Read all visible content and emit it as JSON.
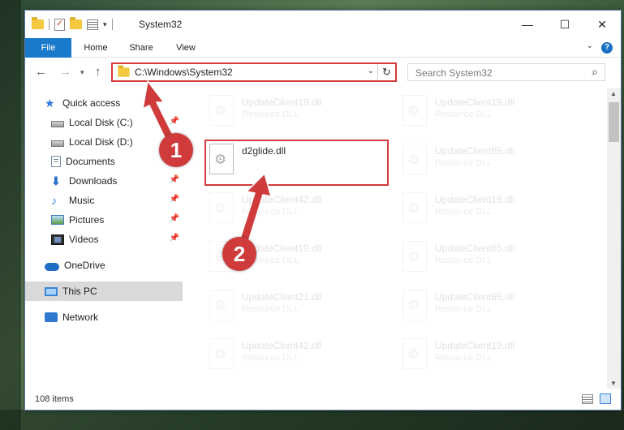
{
  "window": {
    "title": "System32"
  },
  "ribbon": {
    "tabs": [
      "File",
      "Home",
      "Share",
      "View"
    ]
  },
  "address": {
    "path": "C:\\Windows\\System32"
  },
  "search": {
    "placeholder": "Search System32"
  },
  "sidebar": {
    "items": [
      {
        "label": "Quick access",
        "icon": "quick-access-star-icon",
        "pinned": false
      },
      {
        "label": "Local Disk (C:)",
        "icon": "drive-icon",
        "pinned": true
      },
      {
        "label": "Local Disk (D:)",
        "icon": "drive-icon",
        "pinned": false
      },
      {
        "label": "Documents",
        "icon": "documents-icon",
        "pinned": true
      },
      {
        "label": "Downloads",
        "icon": "downloads-icon",
        "pinned": true
      },
      {
        "label": "Music",
        "icon": "music-icon",
        "pinned": true
      },
      {
        "label": "Pictures",
        "icon": "pictures-icon",
        "pinned": true
      },
      {
        "label": "Videos",
        "icon": "videos-icon",
        "pinned": true
      },
      {
        "label": "OneDrive",
        "icon": "onedrive-icon",
        "pinned": false
      },
      {
        "label": "This PC",
        "icon": "this-pc-icon",
        "pinned": false
      },
      {
        "label": "Network",
        "icon": "network-icon",
        "pinned": false
      }
    ]
  },
  "files": [
    {
      "name": "UpdateClient19.dll",
      "type": "Resource DLL"
    },
    {
      "name": "UpdateClient19.dll",
      "type": "Resource DLL"
    },
    {
      "name": "d2glide.dll",
      "type": ""
    },
    {
      "name": "UpdateClient65.dll",
      "type": "Resource DLL"
    },
    {
      "name": "UpdateClient42.dll",
      "type": "Resource DLL"
    },
    {
      "name": "UpdateClient19.dll",
      "type": "Resource DLL"
    },
    {
      "name": "UpdateClient19.dll",
      "type": "Resource DLL"
    },
    {
      "name": "UpdateClient65.dll",
      "type": "Resource DLL"
    },
    {
      "name": "UpdateClient21.dll",
      "type": "Resource DLL"
    },
    {
      "name": "UpdateClient65.dll",
      "type": "Resource DLL"
    },
    {
      "name": "UpdateClient42.dll",
      "type": "Resource DLL"
    },
    {
      "name": "UpdateClient19.dll",
      "type": "Resource DLL"
    }
  ],
  "selected_file": "d2glide.dll",
  "status": {
    "item_count": "108 items"
  },
  "annotations": {
    "step1": "1",
    "step2": "2"
  },
  "colors": {
    "accent": "#1979ca",
    "annotation_red": "#d63a3a"
  }
}
